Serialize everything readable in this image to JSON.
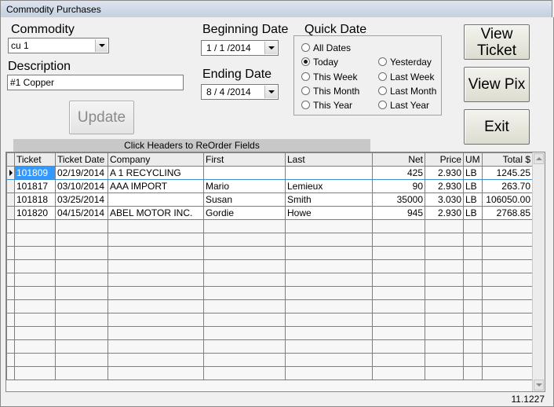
{
  "window": {
    "title": "Commodity Purchases"
  },
  "commodity": {
    "label": "Commodity",
    "value": "cu 1"
  },
  "description": {
    "label": "Description",
    "value": "#1 Copper"
  },
  "begin_date": {
    "label": "Beginning Date",
    "value": "1 / 1 /2014"
  },
  "end_date": {
    "label": "Ending Date",
    "value": "8 / 4 /2014"
  },
  "quick_date": {
    "label": "Quick Date",
    "options": [
      "All Dates",
      "Today",
      "This Week",
      "This Month",
      "This Year",
      "Yesterday",
      "Last Week",
      "Last Month",
      "Last Year"
    ],
    "selected": "Today"
  },
  "buttons": {
    "view_ticket": "View Ticket",
    "view_pix": "View Pix",
    "exit": "Exit",
    "update": "Update"
  },
  "grid": {
    "hint": "Click Headers to ReOrder Fields",
    "columns": [
      "Ticket",
      "Ticket Date",
      "Company",
      "First",
      "Last",
      "Net",
      "Price",
      "UM",
      "Total $"
    ],
    "rows": [
      [
        "101809",
        "02/19/2014",
        "A 1 RECYCLING",
        "",
        "",
        "425",
        "2.930",
        "LB",
        "1245.25"
      ],
      [
        "101817",
        "03/10/2014",
        "AAA IMPORT",
        "Mario",
        "Lemieux",
        "90",
        "2.930",
        "LB",
        "263.70"
      ],
      [
        "101818",
        "03/25/2014",
        "",
        "Susan",
        "Smith",
        "35000",
        "3.030",
        "LB",
        "106050.00"
      ],
      [
        "101820",
        "04/15/2014",
        "ABEL MOTOR INC.",
        "Gordie",
        "Howe",
        "945",
        "2.930",
        "LB",
        "2768.85"
      ]
    ]
  },
  "version": "11.1227"
}
